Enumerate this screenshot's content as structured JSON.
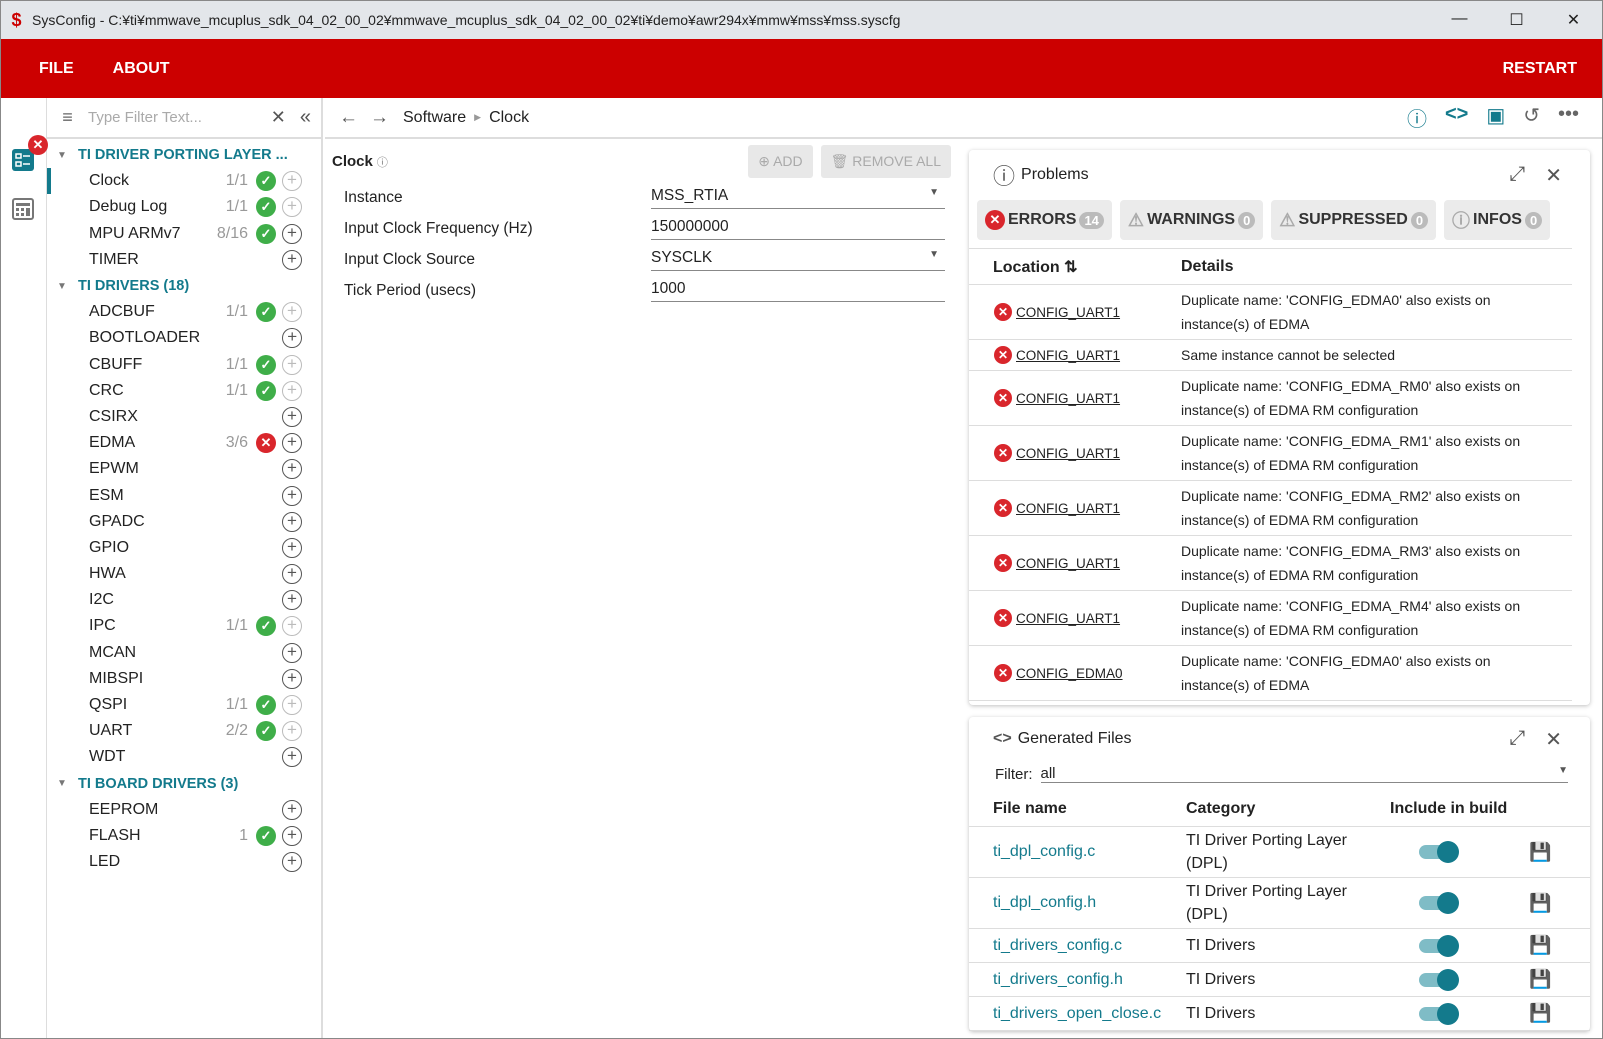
{
  "window": {
    "title": "SysConfig - C:¥ti¥mmwave_mcuplus_sdk_04_02_00_02¥mmwave_mcuplus_sdk_04_02_00_02¥ti¥demo¥awr294x¥mmw¥mss¥mss.syscfg",
    "minimize": "—",
    "maximize": "☐",
    "close": "✕"
  },
  "menu": {
    "file": "FILE",
    "about": "ABOUT",
    "restart": "RESTART"
  },
  "filter": {
    "placeholder": "Type Filter Text..."
  },
  "tree": [
    {
      "header": "TI DRIVER PORTING LAYER ...",
      "items": [
        {
          "name": "Clock",
          "count": "1/1",
          "status": "ok",
          "add": "disabled",
          "selected": true
        },
        {
          "name": "Debug Log",
          "count": "1/1",
          "status": "ok",
          "add": "disabled"
        },
        {
          "name": "MPU ARMv7",
          "count": "8/16",
          "status": "ok",
          "add": "enabled"
        },
        {
          "name": "TIMER",
          "count": "",
          "status": "",
          "add": "enabled"
        }
      ]
    },
    {
      "header": "TI DRIVERS (18)",
      "items": [
        {
          "name": "ADCBUF",
          "count": "1/1",
          "status": "ok",
          "add": "disabled"
        },
        {
          "name": "BOOTLOADER",
          "count": "",
          "status": "",
          "add": "enabled"
        },
        {
          "name": "CBUFF",
          "count": "1/1",
          "status": "ok",
          "add": "disabled"
        },
        {
          "name": "CRC",
          "count": "1/1",
          "status": "ok",
          "add": "disabled"
        },
        {
          "name": "CSIRX",
          "count": "",
          "status": "",
          "add": "enabled"
        },
        {
          "name": "EDMA",
          "count": "3/6",
          "status": "error",
          "add": "enabled"
        },
        {
          "name": "EPWM",
          "count": "",
          "status": "",
          "add": "enabled"
        },
        {
          "name": "ESM",
          "count": "",
          "status": "",
          "add": "enabled"
        },
        {
          "name": "GPADC",
          "count": "",
          "status": "",
          "add": "enabled"
        },
        {
          "name": "GPIO",
          "count": "",
          "status": "",
          "add": "enabled"
        },
        {
          "name": "HWA",
          "count": "",
          "status": "",
          "add": "enabled"
        },
        {
          "name": "I2C",
          "count": "",
          "status": "",
          "add": "enabled"
        },
        {
          "name": "IPC",
          "count": "1/1",
          "status": "ok",
          "add": "disabled"
        },
        {
          "name": "MCAN",
          "count": "",
          "status": "",
          "add": "enabled"
        },
        {
          "name": "MIBSPI",
          "count": "",
          "status": "",
          "add": "enabled"
        },
        {
          "name": "QSPI",
          "count": "1/1",
          "status": "ok",
          "add": "disabled"
        },
        {
          "name": "UART",
          "count": "2/2",
          "status": "ok",
          "add": "disabled"
        },
        {
          "name": "WDT",
          "count": "",
          "status": "",
          "add": "enabled"
        }
      ]
    },
    {
      "header": "TI BOARD DRIVERS (3)",
      "items": [
        {
          "name": "EEPROM",
          "count": "",
          "status": "",
          "add": "enabled"
        },
        {
          "name": "FLASH",
          "count": "1",
          "status": "ok",
          "add": "enabled"
        },
        {
          "name": "LED",
          "count": "",
          "status": "",
          "add": "enabled"
        }
      ]
    }
  ],
  "breadcrumb": [
    "Software",
    "Clock"
  ],
  "config": {
    "title": "Clock",
    "add": "ADD",
    "remove_all": "REMOVE ALL",
    "fields": [
      {
        "label": "Instance",
        "value": "MSS_RTIA",
        "dropdown": true
      },
      {
        "label": "Input Clock Frequency (Hz)",
        "value": "150000000",
        "dropdown": false
      },
      {
        "label": "Input Clock Source",
        "value": "SYSCLK",
        "dropdown": true
      },
      {
        "label": "Tick Period (usecs)",
        "value": "1000",
        "dropdown": false
      }
    ]
  },
  "problems": {
    "title": "Problems",
    "tabs": [
      {
        "label": "ERRORS",
        "count": "14"
      },
      {
        "label": "WARNINGS",
        "count": "0"
      },
      {
        "label": "SUPPRESSED",
        "count": "0"
      },
      {
        "label": "INFOS",
        "count": "0"
      }
    ],
    "col_location": "Location",
    "col_details": "Details",
    "rows": [
      {
        "location": "CONFIG_UART1",
        "details": "Duplicate name: 'CONFIG_EDMA0' also exists on instance(s) of EDMA"
      },
      {
        "location": "CONFIG_UART1",
        "details": "Same instance cannot be selected"
      },
      {
        "location": "CONFIG_UART1",
        "details": "Duplicate name: 'CONFIG_EDMA_RM0' also exists on instance(s) of EDMA RM configuration"
      },
      {
        "location": "CONFIG_UART1",
        "details": "Duplicate name: 'CONFIG_EDMA_RM1' also exists on instance(s) of EDMA RM configuration"
      },
      {
        "location": "CONFIG_UART1",
        "details": "Duplicate name: 'CONFIG_EDMA_RM2' also exists on instance(s) of EDMA RM configuration"
      },
      {
        "location": "CONFIG_UART1",
        "details": "Duplicate name: 'CONFIG_EDMA_RM3' also exists on instance(s) of EDMA RM configuration"
      },
      {
        "location": "CONFIG_UART1",
        "details": "Duplicate name: 'CONFIG_EDMA_RM4' also exists on instance(s) of EDMA RM configuration"
      },
      {
        "location": "CONFIG_EDMA0",
        "details": "Duplicate name: 'CONFIG_EDMA0' also exists on instance(s) of EDMA"
      }
    ]
  },
  "generated": {
    "title": "Generated Files",
    "filter_label": "Filter:",
    "filter_value": "all",
    "col_file": "File name",
    "col_category": "Category",
    "col_include": "Include in build",
    "files": [
      {
        "name": "ti_dpl_config.c",
        "category": "TI Driver Porting Layer (DPL)",
        "include": true
      },
      {
        "name": "ti_dpl_config.h",
        "category": "TI Driver Porting Layer (DPL)",
        "include": true
      },
      {
        "name": "ti_drivers_config.c",
        "category": "TI Drivers",
        "include": true
      },
      {
        "name": "ti_drivers_config.h",
        "category": "TI Drivers",
        "include": true
      },
      {
        "name": "ti_drivers_open_close.c",
        "category": "TI Drivers",
        "include": true
      }
    ]
  },
  "colors": {
    "brand": "#cc0000",
    "accent": "#137a8c",
    "ok": "#3fae49",
    "error": "#d9262c"
  }
}
